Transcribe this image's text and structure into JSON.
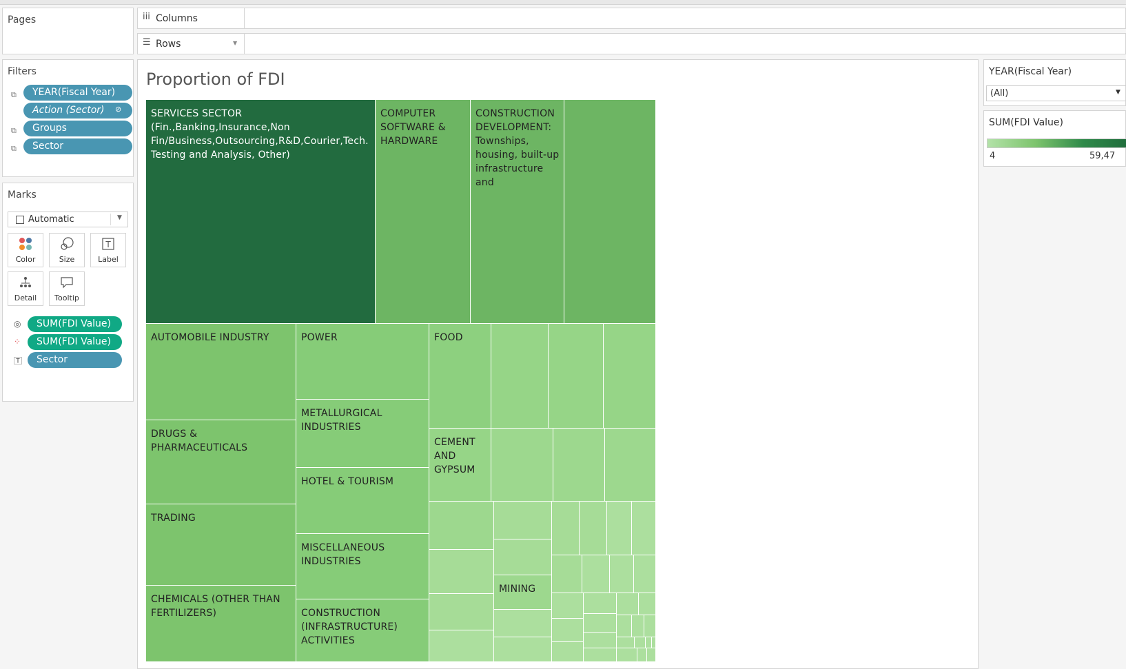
{
  "pages_panel": {
    "title": "Pages"
  },
  "shelves": {
    "columns_label": "Columns",
    "rows_label": "Rows"
  },
  "filters": {
    "title": "Filters",
    "pills": [
      "YEAR(Fiscal Year)",
      "Action (Sector)",
      "Groups",
      "Sector"
    ]
  },
  "marks": {
    "title": "Marks",
    "mark_type": "Automatic",
    "cards": [
      "Color",
      "Size",
      "Label",
      "Detail",
      "Tooltip"
    ],
    "pills": [
      "SUM(FDI Value)",
      "SUM(FDI Value)",
      "Sector"
    ]
  },
  "sheet": {
    "title": "Proportion of FDI"
  },
  "year_filter": {
    "title": "YEAR(Fiscal Year)",
    "value": "(All)"
  },
  "legend": {
    "title": "SUM(FDI Value)",
    "min": "4",
    "max": "59,47",
    "color_low": "#b3e2a8",
    "color_high": "#1f6b3b"
  },
  "chart_data": {
    "type": "treemap",
    "title": "Proportion of FDI",
    "labeled_cells": [
      "SERVICES SECTOR (Fin.,Banking,Insurance,Non Fin/Business,Outsourcing,R&D,Courier,Tech. Testing and Analysis, Other)",
      "COMPUTER SOFTWARE & HARDWARE",
      "CONSTRUCTION DEVELOPMENT: Townships, housing, built-up infrastructure and",
      "AUTOMOBILE INDUSTRY",
      "POWER",
      "FOOD",
      "DRUGS & PHARMACEUTICALS",
      "METALLURGICAL INDUSTRIES",
      "CEMENT AND GYPSUM",
      "HOTEL & TOURISM",
      "TRADING",
      "MISCELLANEOUS INDUSTRIES",
      "MINING",
      "CHEMICALS (OTHER THAN FERTILIZERS)",
      "CONSTRUCTION (INFRASTRUCTURE) ACTIVITIES"
    ]
  }
}
